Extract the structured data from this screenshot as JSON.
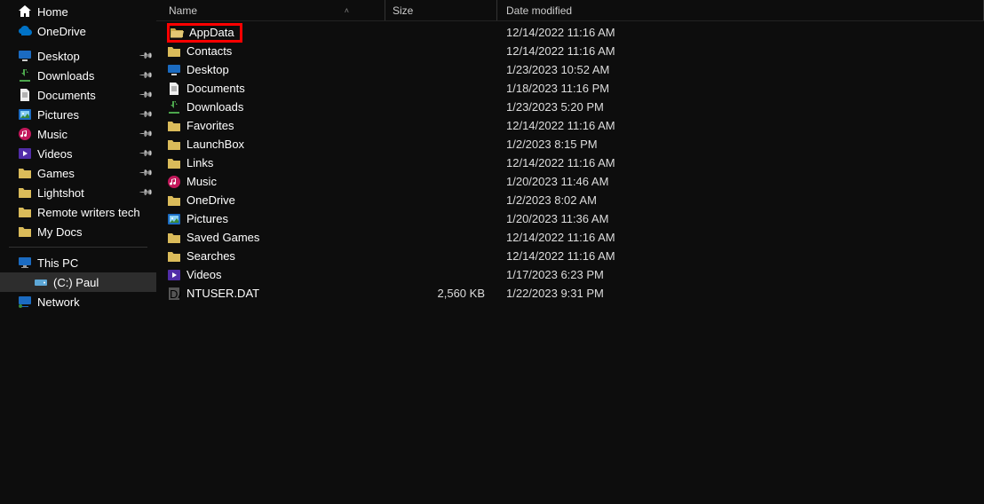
{
  "columns": {
    "name": "Name",
    "size": "Size",
    "date": "Date modified"
  },
  "sidebar": {
    "top": [
      {
        "label": "Home",
        "icon": "home"
      },
      {
        "label": "OneDrive",
        "icon": "onedrive"
      }
    ],
    "quick": [
      {
        "label": "Desktop",
        "icon": "desktop",
        "pinned": true
      },
      {
        "label": "Downloads",
        "icon": "download",
        "pinned": true
      },
      {
        "label": "Documents",
        "icon": "doc",
        "pinned": true
      },
      {
        "label": "Pictures",
        "icon": "pic",
        "pinned": true
      },
      {
        "label": "Music",
        "icon": "music",
        "pinned": true
      },
      {
        "label": "Videos",
        "icon": "video",
        "pinned": true
      },
      {
        "label": "Games",
        "icon": "folder",
        "pinned": true
      },
      {
        "label": "Lightshot",
        "icon": "folder",
        "pinned": true
      },
      {
        "label": "Remote writers tech",
        "icon": "folder",
        "pinned": false
      },
      {
        "label": "My Docs",
        "icon": "folder",
        "pinned": false
      }
    ],
    "bottom": [
      {
        "label": "This PC",
        "icon": "monitor",
        "indent": false,
        "selected": false
      },
      {
        "label": "(C:) Paul",
        "icon": "drive",
        "indent": true,
        "selected": true
      },
      {
        "label": "Network",
        "icon": "network",
        "indent": false,
        "selected": false
      }
    ]
  },
  "files": [
    {
      "name": "AppData",
      "icon": "folder-open",
      "size": "",
      "date": "12/14/2022 11:16 AM",
      "highlight": true
    },
    {
      "name": "Contacts",
      "icon": "folder",
      "size": "",
      "date": "12/14/2022 11:16 AM"
    },
    {
      "name": "Desktop",
      "icon": "desktop",
      "size": "",
      "date": "1/23/2023 10:52 AM"
    },
    {
      "name": "Documents",
      "icon": "doc",
      "size": "",
      "date": "1/18/2023 11:16 PM"
    },
    {
      "name": "Downloads",
      "icon": "download",
      "size": "",
      "date": "1/23/2023 5:20 PM"
    },
    {
      "name": "Favorites",
      "icon": "folder",
      "size": "",
      "date": "12/14/2022 11:16 AM"
    },
    {
      "name": "LaunchBox",
      "icon": "folder",
      "size": "",
      "date": "1/2/2023 8:15 PM"
    },
    {
      "name": "Links",
      "icon": "folder",
      "size": "",
      "date": "12/14/2022 11:16 AM"
    },
    {
      "name": "Music",
      "icon": "music",
      "size": "",
      "date": "1/20/2023 11:46 AM"
    },
    {
      "name": "OneDrive",
      "icon": "folder",
      "size": "",
      "date": "1/2/2023 8:02 AM"
    },
    {
      "name": "Pictures",
      "icon": "pic",
      "size": "",
      "date": "1/20/2023 11:36 AM"
    },
    {
      "name": "Saved Games",
      "icon": "folder",
      "size": "",
      "date": "12/14/2022 11:16 AM"
    },
    {
      "name": "Searches",
      "icon": "folder",
      "size": "",
      "date": "12/14/2022 11:16 AM"
    },
    {
      "name": "Videos",
      "icon": "video",
      "size": "",
      "date": "1/17/2023 6:23 PM"
    },
    {
      "name": "NTUSER.DAT",
      "icon": "dat",
      "size": "2,560 KB",
      "date": "1/22/2023 9:31 PM"
    }
  ]
}
